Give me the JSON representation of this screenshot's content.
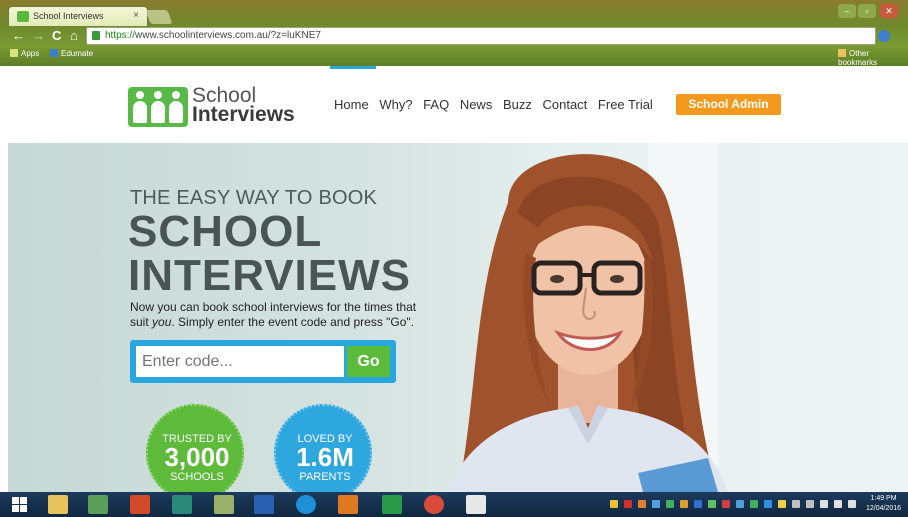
{
  "browser": {
    "tab_title": "School Interviews",
    "tab_close": "×",
    "url_scheme": "https://",
    "url_rest": "www.schoolinterviews.com.au/?z=luKNE7",
    "bookmarks": [
      {
        "label": "Apps"
      },
      {
        "label": "Edumate"
      }
    ],
    "other_bookmarks": "Other bookmarks"
  },
  "site": {
    "logo_line1": "School",
    "logo_line2": "Interviews",
    "nav": [
      "Home",
      "Why?",
      "FAQ",
      "News",
      "Buzz",
      "Contact",
      "Free Trial"
    ],
    "admin_button": "School Admin"
  },
  "hero": {
    "tagline": "THE EASY WAY TO BOOK",
    "title_line1": "SCHOOL",
    "title_line2": "INTERVIEWS",
    "sub_line1": "Now you can book school interviews for the times that",
    "sub_line2_pre": "suit ",
    "sub_line2_em": "you",
    "sub_line2_post": ". Simply enter the event code and press \"Go\".",
    "code_placeholder": "Enter code...",
    "go_button": "Go",
    "badge_trusted": {
      "top": "TRUSTED BY",
      "number": "3,000",
      "bottom": "SCHOOLS"
    },
    "badge_loved": {
      "top": "LOVED BY",
      "number": "1.6M",
      "bottom": "PARENTS"
    }
  },
  "taskbar": {
    "time": "1:49 PM",
    "date": "12/04/2016"
  },
  "colors": {
    "brand_green": "#58b947",
    "brand_blue": "#27a6e0",
    "brand_orange": "#f39a1e"
  }
}
